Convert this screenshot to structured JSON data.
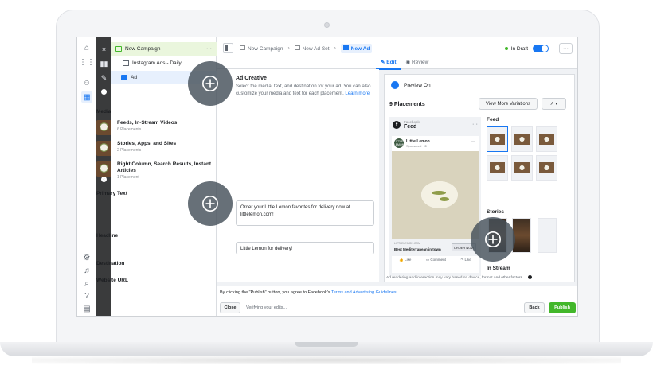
{
  "breadcrumbs": {
    "campaign": "New Campaign",
    "adset": "New Ad Set",
    "ad": "New Ad"
  },
  "status": {
    "draft_label": "In Draft",
    "more_label": "···"
  },
  "tabs": [
    {
      "label": "Edit",
      "active": true
    },
    {
      "label": "Review",
      "active": false
    }
  ],
  "tree": {
    "campaign": "New Campaign",
    "campaign_more": "···",
    "adset": "Instagram Ads - Daily",
    "ad": "Ad"
  },
  "rail": {
    "close": "×"
  },
  "editor": {
    "title": "Ad Creative",
    "description": "Select the media, text, and destination for your ad. You can also customize your media and text for each placement.",
    "learn_more": "Learn more",
    "media_heading": "Media",
    "placements": [
      {
        "title": "Feeds, In-Stream Videos",
        "sub": "6 Placements"
      },
      {
        "title": "Stories, Apps, and Sites",
        "sub": "2 Placements"
      },
      {
        "title": "Right Column, Search Results, Instant Articles",
        "sub": "1 Placement"
      }
    ],
    "primary_text_heading": "Primary Text",
    "primary_text_value": "Order your Little Lemon favorites for delivery now at littlelemon.com!",
    "headline_heading": "Headline",
    "headline_value": "Little Lemon for delivery!",
    "destination_heading": "Destination",
    "website_url_heading": "Website URL"
  },
  "preview": {
    "toggle_label": "Preview On",
    "placements_count": "9 Placements",
    "view_more": "View More Variations",
    "share_label": "↗ ▾",
    "platform": "Facebook",
    "section": "Feed",
    "page_name": "Little Lemon",
    "sponsored": "Sponsored · ⊕",
    "avatar_text": "LITTLE LEMON",
    "link_url": "LITTLELEMON.COM",
    "link_title": "Best Mediterranean in town",
    "cta": "ORDER NOW",
    "actions": [
      "Like",
      "Comment",
      "Like"
    ],
    "feed_heading": "Feed",
    "stories_heading": "Stories",
    "instream_heading": "In Stream",
    "note": "Ad rendering and interaction may vary based on device, format and other factors."
  },
  "footer": {
    "terms_prefix": "By clicking the \"Publish\" button, you agree to Facebook's",
    "terms_link": "Terms and Advertising Guidelines",
    "terms_suffix": ".",
    "close": "Close",
    "verifying": "Verifying your edits...",
    "back": "Back",
    "publish": "Publish"
  },
  "colors": {
    "accent": "#1877f2",
    "publish_green": "#42b72a",
    "dark_sidebar": "#3a3b3c"
  },
  "icons": {
    "hotspot": "plus-circle-icon"
  }
}
